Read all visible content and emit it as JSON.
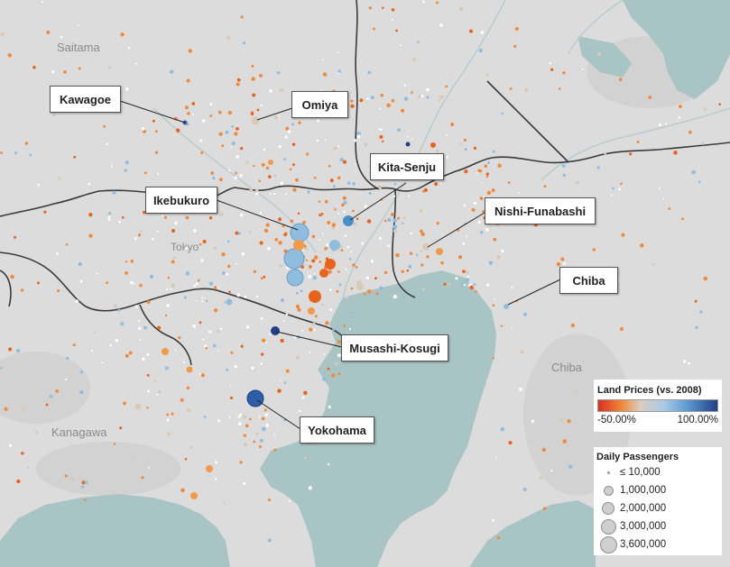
{
  "map": {
    "regions": {
      "saitama": "Saitama",
      "tokyo": "Tokyo",
      "kanagawa": "Kanagawa",
      "chiba": "Chiba"
    },
    "stations": {
      "kawagoe": "Kawagoe",
      "omiya": "Omiya",
      "kita_senju": "Kita-Senju",
      "ikebukuro": "Ikebukuro",
      "nishi_funabashi": "Nishi-Funabashi",
      "chiba": "Chiba",
      "musashi_kosugi": "Musashi-Kosugi",
      "yokohama": "Yokohama"
    },
    "colors": {
      "land": "#dcdcdc",
      "water": "#a9c4c4",
      "border": "#3a3a3a",
      "decline": "#e8641b",
      "neutral": "#d9c9b5",
      "rise_light": "#8fbde0",
      "rise_mid": "#4a8fc9",
      "rise_strong": "#1f3f86"
    }
  },
  "legend": {
    "color": {
      "title": "Land Prices (vs. 2008)",
      "min_label": "-50.00%",
      "max_label": "100.00%"
    },
    "size": {
      "title": "Daily Passengers",
      "items": [
        {
          "label": "≤ 10,000",
          "value": 10000
        },
        {
          "label": "1,000,000",
          "value": 1000000
        },
        {
          "label": "2,000,000",
          "value": 2000000
        },
        {
          "label": "3,000,000",
          "value": 3000000
        },
        {
          "label": "3,600,000",
          "value": 3600000
        }
      ]
    }
  }
}
